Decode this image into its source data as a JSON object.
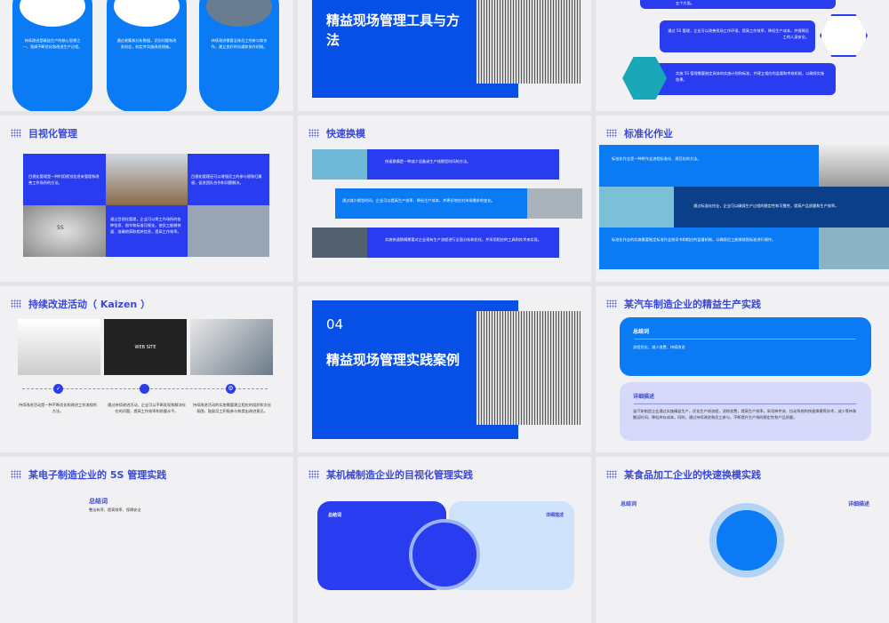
{
  "slides": [
    {
      "cards": [
        "持续改进是精益生产的核心思想之一，强调不断优化和改进生产过程。",
        "通过收集和分析数据，识别问题和改进机会，制定并实施改进措施。",
        "持续改进需要全体员工的参与和合作，建立良好的沟通和协作机制。"
      ]
    },
    {
      "title": "精益现场管理工具与方法"
    },
    {
      "items": [
        "五个方面。",
        "通过 5S 管理，企业可以改善现场工作环境，提高工作效率，降低生产成本，并保障员工的人身安全。",
        "实施 5S 管理需要制定具体的实施计划和标准，并建立相应的监督和考核机制，以确保实施效果。"
      ]
    },
    {
      "title": "目视化管理",
      "texts": [
        "目视化管理是一种利用视觉信息来管理和改善工作场所的方法。",
        "目视化管理还可以增强员工的参与感和归属感，促进团队合作和问题解决。",
        "通过目视化管理，企业可以将工作场所的各种信息、指令和标准可视化，使员工能够快速、准确地获取相关信息，提高工作效率。"
      ],
      "center_label": "5S"
    },
    {
      "title": "快速换模",
      "texts": [
        "快速换模是一种减少设备或生产线换型时间的方法。",
        "通过减少换型时间，企业可以提高生产效率，降低生产成本，并更好地应对市场需求的变化。",
        "实施快速换模需要对企业现有生产流程进行全面分析和优化，并采用相应的工具和技术来实现。"
      ]
    },
    {
      "title": "标准化作业",
      "texts": [
        "标准化作业是一种将作业流程标准化、规范化的方法。",
        "通过标准化作业，企业可以确保生产过程的稳定性和可靠性，提高产品质量和生产效率。",
        "标准化作业的实施需要制定标准作业指导书和相应的监督机制，以确保员工能够按照标准进行操作。"
      ]
    },
    {
      "title": "持续改进活动（ Kaizen ）",
      "texts": [
        "持续改进活动是一种不断优化和改进工作流程的方法。",
        "通过持续改进活动，企业可以不断发现和解决存在的问题，提高工作效率和质量水平。",
        "持续改进活动的实施需要建立相应的组织和文化氛围，鼓励员工积极参与和提出改进意见。"
      ],
      "web_label": "WEB SITE"
    },
    {
      "number": "04",
      "title": "精益现场管理实践案例"
    },
    {
      "title": "某汽车制造企业的精益生产实践",
      "summary_label": "总结词",
      "summary": "流程优化、减少浪费、持续改进",
      "detail_label": "详细描述",
      "detail": "该汽车制造企业通过实施精益生产，优化生产线流程，消除浪费，提高生产效率。采用单件流、拉动系统和快速换模等技术，减少等待和搬运时间，降低库存成本。同时，通过持续改进和员工参与，不断提升生产线的稳定性和产品质量。"
    },
    {
      "title": "某电子制造企业的 5S 管理实践",
      "summary_label": "总结词",
      "summary": "整洁有序、提高效率、保障安全"
    },
    {
      "title": "某机械制造企业的目视化管理实践",
      "summary_label": "总结词",
      "detail_label": "详细描述"
    },
    {
      "title": "某食品加工企业的快速换模实践",
      "summary_label": "总结词",
      "detail_label": "详细描述"
    }
  ],
  "colors": {
    "blue": "#2a3cf0",
    "sky": "#0a7bf5",
    "navy": "#0c3f8a",
    "title": "#3a48d6"
  }
}
